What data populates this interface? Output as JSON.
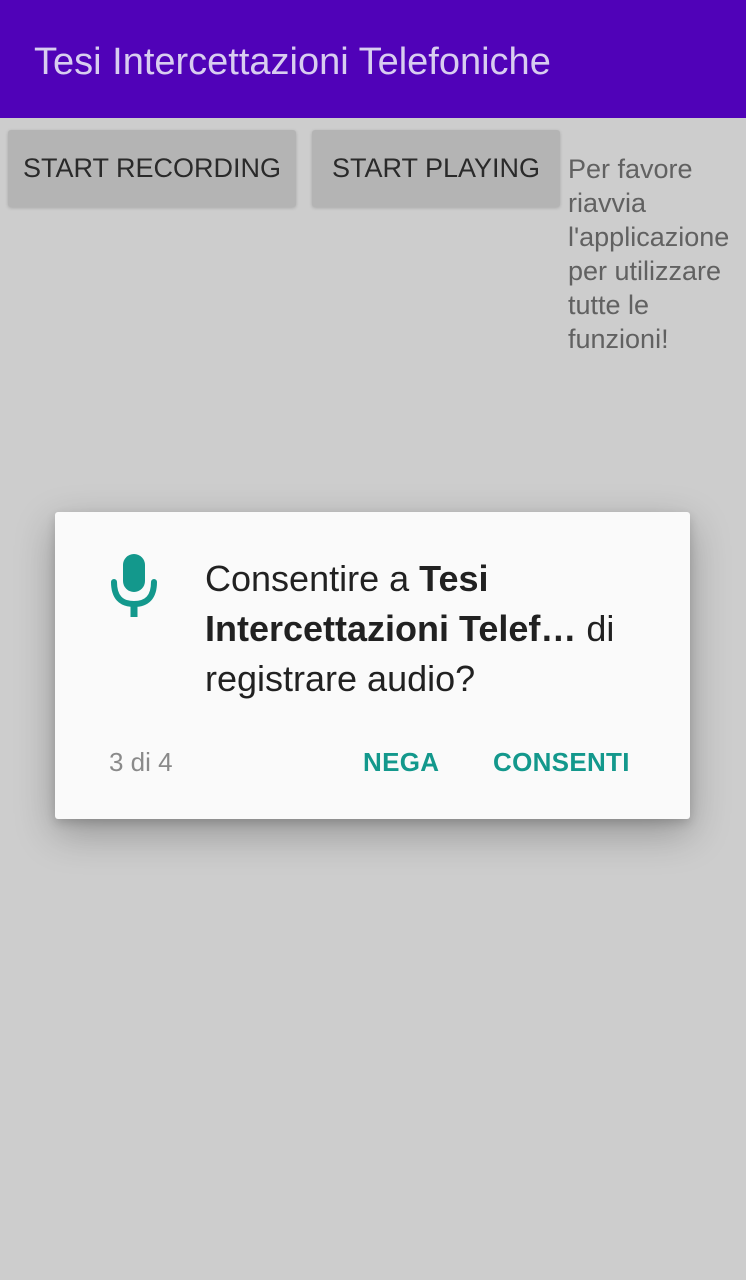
{
  "app_bar": {
    "title": "Tesi Intercettazioni Telefoniche",
    "background": "#5002b8"
  },
  "buttons": {
    "start_recording": "START RECORDING",
    "start_playing": "START PLAYING"
  },
  "notice": "Per favore riavvia l'applicazione per utilizzare tutte le funzioni!",
  "permission_dialog": {
    "icon": "microphone-icon",
    "message_prefix": "Consentire a ",
    "app_name": "Tesi Intercettazioni Telef…",
    "message_suffix": " di registrare audio?",
    "counter": "3 di 4",
    "deny_label": "NEGA",
    "allow_label": "CONSENTI",
    "accent": "#13988c"
  }
}
